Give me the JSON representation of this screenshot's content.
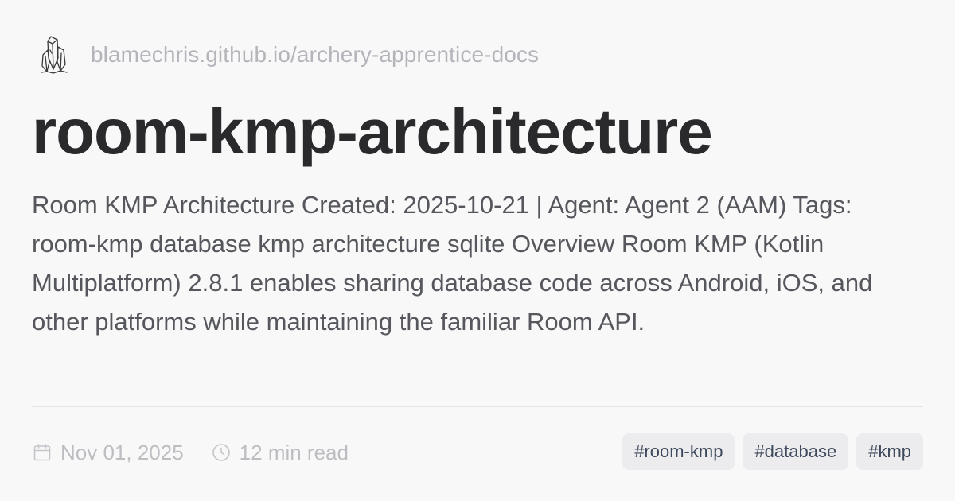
{
  "site": {
    "logo_icon": "crystal-logo-icon",
    "url": "blamechris.github.io/archery-apprentice-docs"
  },
  "page": {
    "title": "room-kmp-architecture",
    "description": "Room KMP Architecture Created: 2025-10-21 | Agent: Agent 2 (AAM) Tags: room-kmp database kmp architecture sqlite Overview Room KMP (Kotlin Multiplatform) 2.8.1 enables sharing database code across Android, iOS, and other platforms while maintaining the familiar Room API."
  },
  "meta": {
    "date_icon": "calendar-icon",
    "date": "Nov 01, 2025",
    "read_icon": "clock-icon",
    "read_time": "12 min read"
  },
  "tags": [
    "#room-kmp",
    "#database",
    "#kmp"
  ],
  "colors": {
    "background": "#f8f8f9",
    "title": "#2a2a2c",
    "body_text": "#55575c",
    "muted_text": "#b3b5ba",
    "tag_bg": "#ececef",
    "tag_text": "#3e4a5c"
  }
}
